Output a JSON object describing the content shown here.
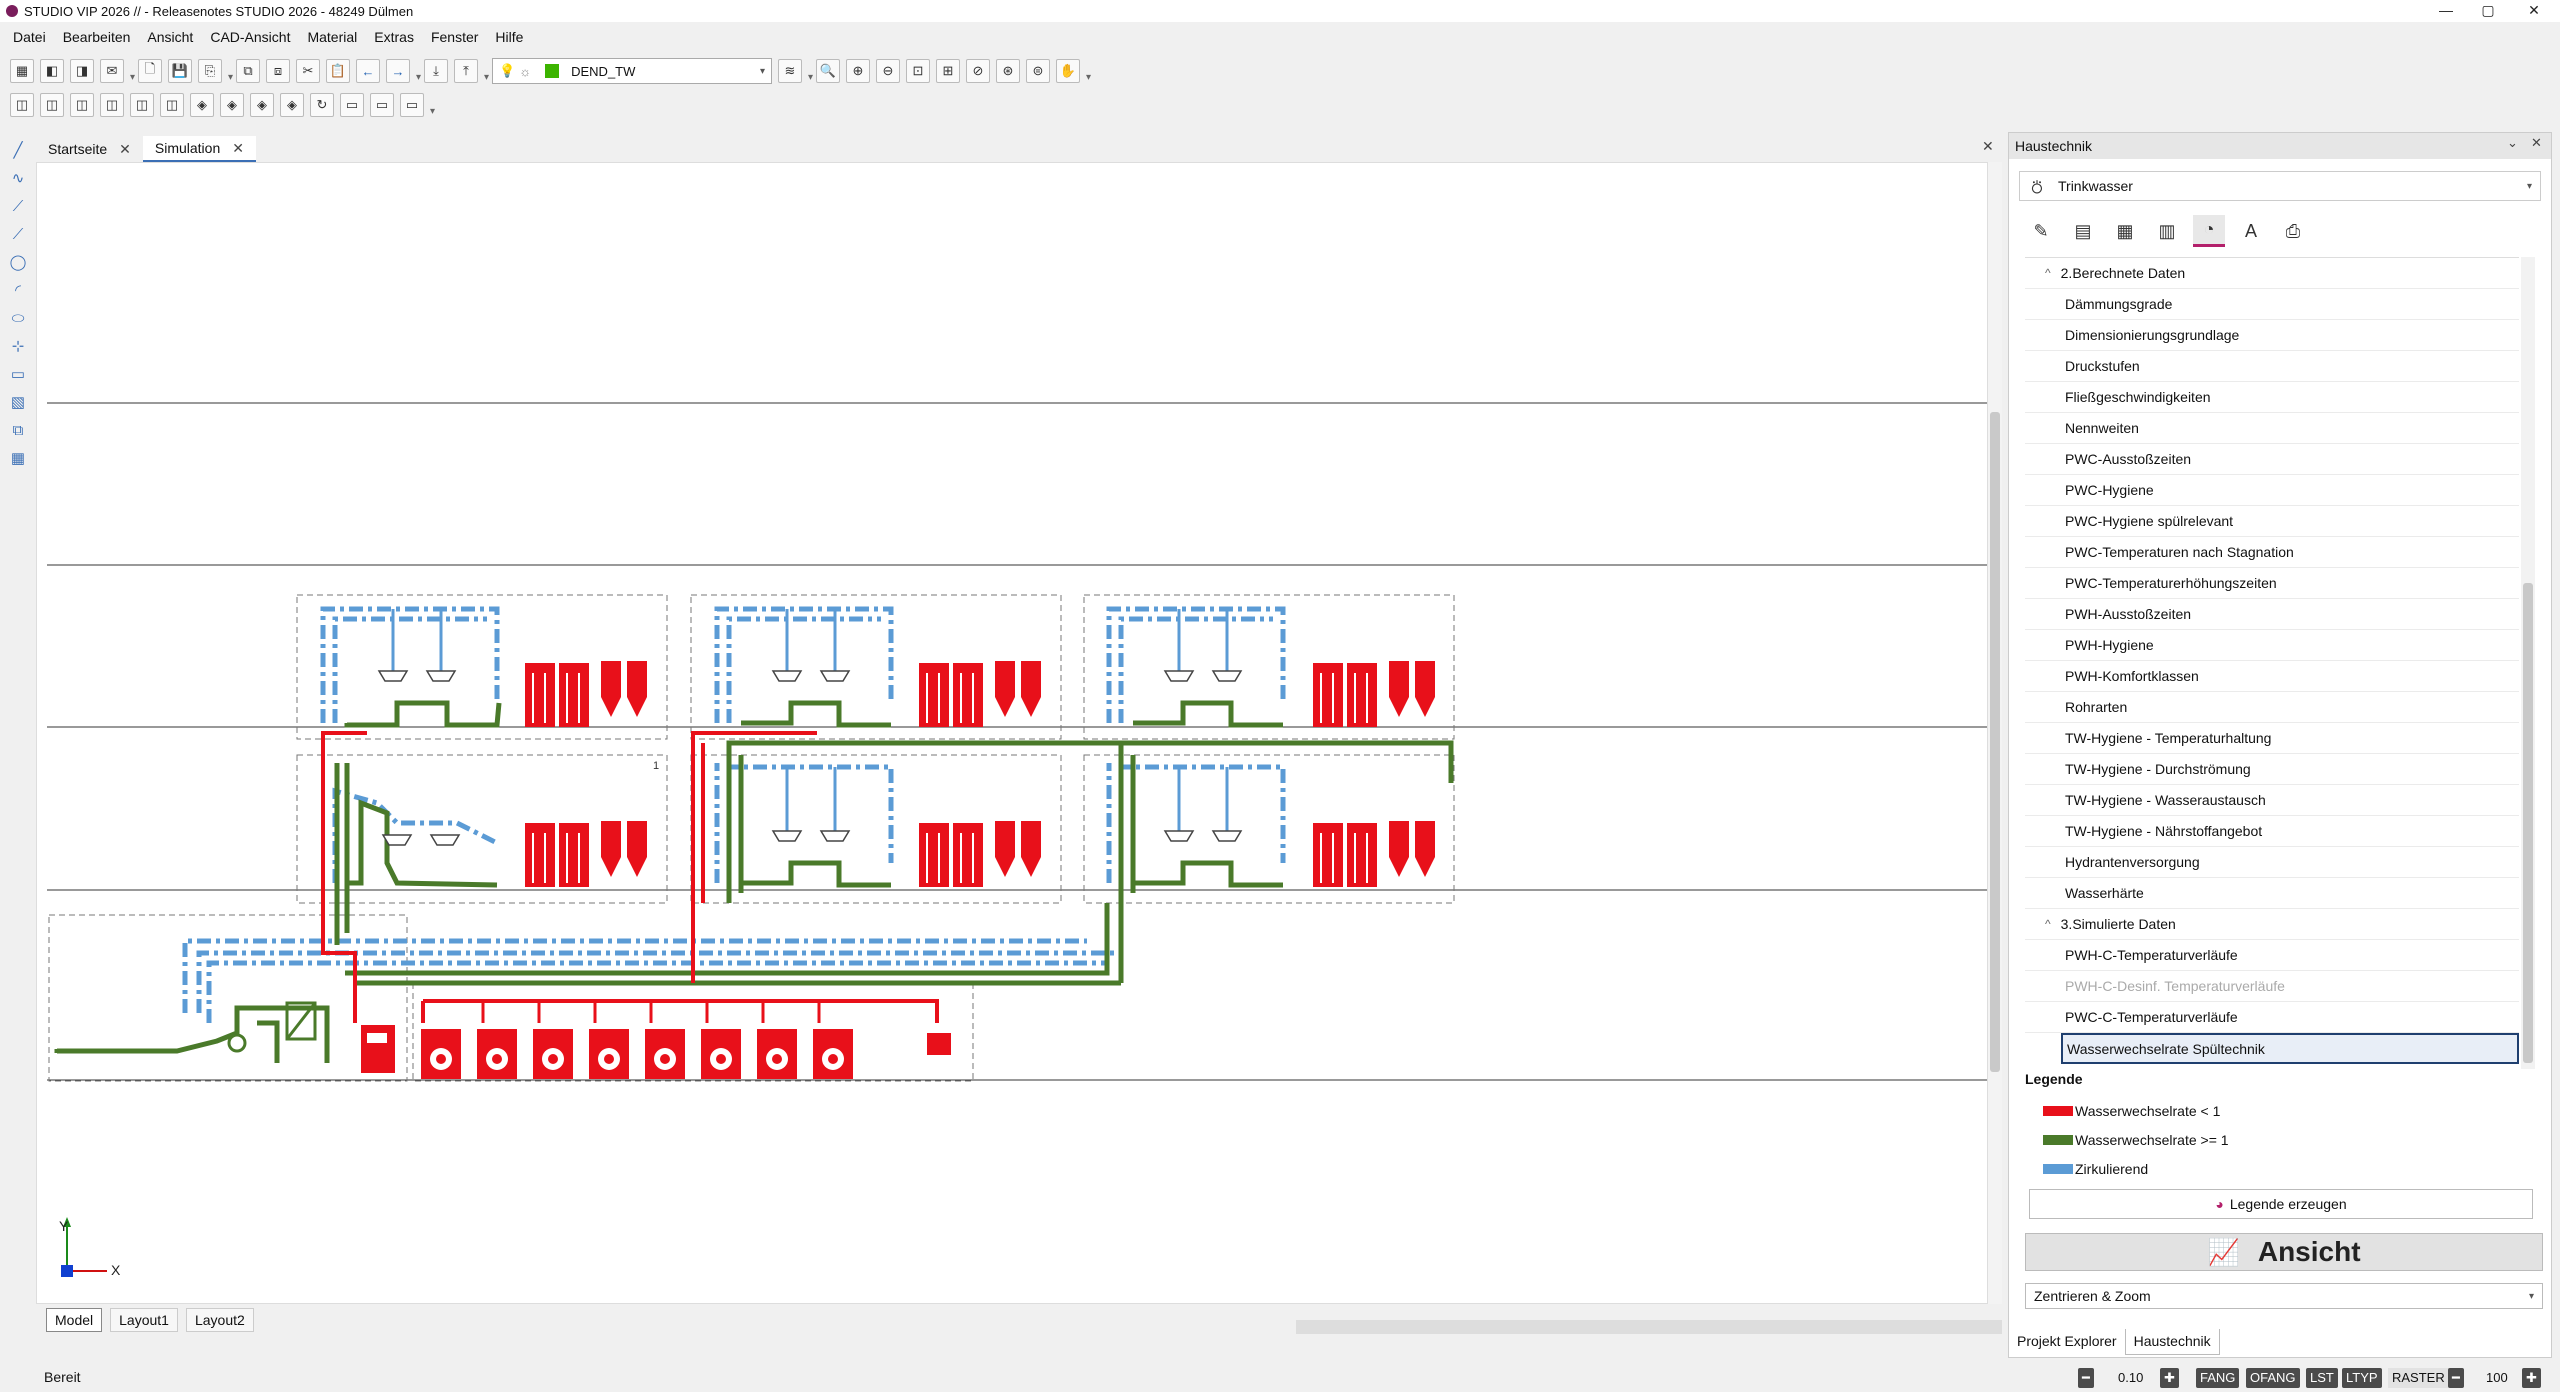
{
  "window": {
    "title": "STUDIO VIP 2026 //  - Releasenotes STUDIO 2026 - 48249 Dülmen",
    "controls": [
      "—",
      "▢",
      "✕"
    ]
  },
  "menu": [
    "Datei",
    "Bearbeiten",
    "Ansicht",
    "CAD-Ansicht",
    "Material",
    "Extras",
    "Fenster",
    "Hilfe"
  ],
  "toolbar": {
    "layer_combo": "DEND_TW"
  },
  "doc_tabs": [
    {
      "label": "Startseite"
    },
    {
      "label": "Simulation"
    }
  ],
  "layout_tabs": [
    "Model",
    "Layout1",
    "Layout2"
  ],
  "axes": {
    "y": "Y",
    "x": "X"
  },
  "status": {
    "text": "Bereit",
    "value1": "0.10",
    "buttons": [
      "FANG",
      "OFANG",
      "LST",
      "LTYP",
      "RASTER"
    ],
    "value2": "100"
  },
  "panel": {
    "title": "Haustechnik",
    "combo": "Trinkwasser",
    "groups": [
      {
        "label": "2.Berechnete Daten",
        "items": [
          "Dämmungsgrade",
          "Dimensionierungsgrundlage",
          "Druckstufen",
          "Fließgeschwindigkeiten",
          "Nennweiten",
          "PWC-Ausstoßzeiten",
          "PWC-Hygiene",
          "PWC-Hygiene spülrelevant",
          "PWC-Temperaturen nach Stagnation",
          "PWC-Temperaturerhöhungszeiten",
          "PWH-Ausstoßzeiten",
          "PWH-Hygiene",
          "PWH-Komfortklassen",
          "Rohrarten",
          "TW-Hygiene - Temperaturhaltung",
          "TW-Hygiene - Durchströmung",
          "TW-Hygiene - Wasseraustausch",
          "TW-Hygiene - Nährstoffangebot",
          "Hydrantenversorgung",
          "Wasserhärte"
        ]
      },
      {
        "label": "3.Simulierte Daten",
        "items": [
          "PWH-C-Temperaturverläufe",
          "PWH-C-Desinf. Temperaturverläufe",
          "PWC-C-Temperaturverläufe",
          "Wasserwechselrate Spültechnik"
        ]
      }
    ],
    "legend_title": "Legende",
    "legend": [
      {
        "label": "Wasserwechselrate < 1",
        "color": "#e8101a"
      },
      {
        "label": "Wasserwechselrate >= 1",
        "color": "#4a7a2a"
      },
      {
        "label": "Zirkulierend",
        "color": "#5b9bd5"
      }
    ],
    "legend_button": "Legende erzeugen",
    "ansicht_button": "Ansicht",
    "zoom_combo": "Zentrieren & Zoom",
    "bottom_tabs": [
      "Projekt Explorer",
      "Haustechnik"
    ]
  },
  "colors": {
    "red": "#e8101a",
    "green": "#4a7a2a",
    "blue": "#5b9bd5",
    "accent": "#b3206b"
  }
}
